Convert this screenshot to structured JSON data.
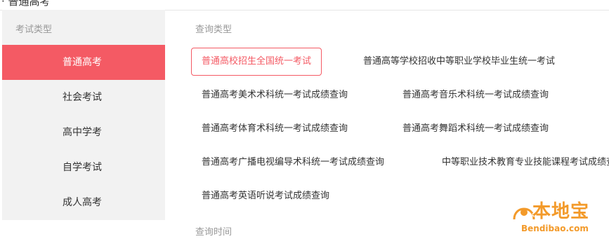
{
  "page": {
    "top_title": "· 普通高考"
  },
  "sidebar": {
    "header": "考试类型",
    "items": [
      {
        "label": "普通高考",
        "active": true
      },
      {
        "label": "社会考试",
        "active": false
      },
      {
        "label": "高中学考",
        "active": false
      },
      {
        "label": "自学考试",
        "active": false
      },
      {
        "label": "成人高考",
        "active": false
      }
    ]
  },
  "main": {
    "query_type_label": "查询类型",
    "options": [
      "普通高校招生全国统一考试",
      "普通高等学校招收中等职业学校毕业生统一考试",
      "普通高考美术术科统一考试成绩查询",
      "普通高考音乐术科统一考试成绩查询",
      "普通高考体育术科统一考试成绩查询",
      "普通高考舞蹈术科统一考试成绩查询",
      "普通高考广播电视编导术科统一考试成绩查询",
      "中等职业技术教育专业技能课程考试成绩查询",
      "普通高考英语听说考试成绩查询"
    ],
    "selected_option": "普通高校招生全国统一考试",
    "query_time_label": "查询时间"
  },
  "watermark": {
    "logo_text": "本地宝",
    "url": "Bendibao.com"
  },
  "colors": {
    "accent": "#f45a64",
    "sidebar_bg": "#f2f2f2",
    "muted_text": "#999999",
    "watermark": "#f39a2a"
  }
}
